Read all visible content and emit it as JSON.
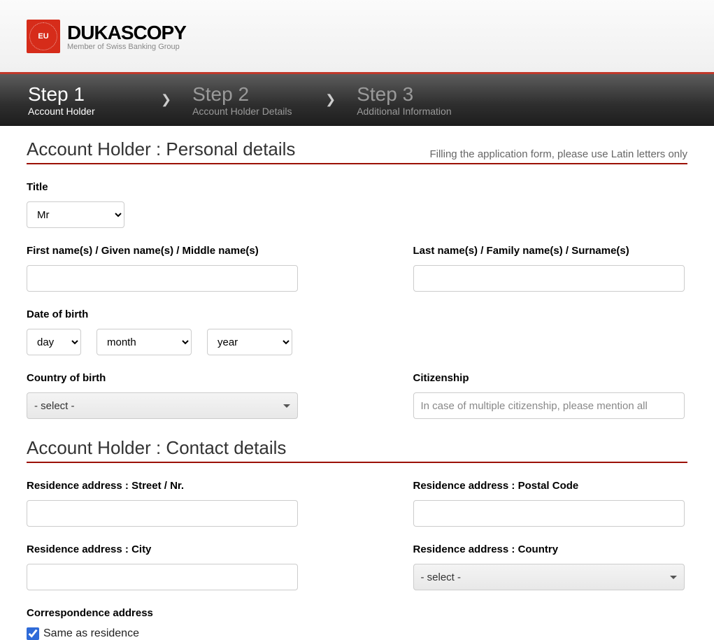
{
  "logo": {
    "badge_text": "EU",
    "brand": "DUKASCOPY",
    "tagline": "Member of Swiss Banking Group"
  },
  "steps": [
    {
      "title": "Step 1",
      "sub": "Account Holder",
      "active": true
    },
    {
      "title": "Step 2",
      "sub": "Account Holder Details",
      "active": false
    },
    {
      "title": "Step 3",
      "sub": "Additional Information",
      "active": false
    }
  ],
  "sections": {
    "personal": {
      "heading": "Account Holder : Personal details",
      "note": "Filling the application form, please use Latin letters only"
    },
    "contact": {
      "heading": "Account Holder : Contact details"
    }
  },
  "labels": {
    "title": "Title",
    "first_name": "First name(s) / Given name(s) / Middle name(s)",
    "last_name": "Last name(s) / Family name(s) / Surname(s)",
    "dob": "Date of birth",
    "country_of_birth": "Country of birth",
    "citizenship": "Citizenship",
    "street": "Residence address : Street / Nr.",
    "postal": "Residence address : Postal Code",
    "city": "Residence address : City",
    "country": "Residence address : Country",
    "correspondence": "Correspondence address",
    "same_as_residence": "Same as residence"
  },
  "values": {
    "title_selected": "Mr",
    "day_placeholder": "day",
    "month_placeholder": "month",
    "year_placeholder": "year",
    "select_placeholder": "- select -",
    "citizenship_placeholder": "In case of multiple citizenship, please mention all",
    "same_as_residence_checked": true
  }
}
